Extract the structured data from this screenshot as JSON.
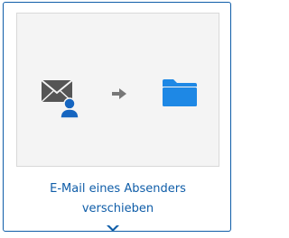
{
  "tile": {
    "caption_line1": "E-Mail eines Absenders",
    "caption_line2": "verschieben",
    "icons": [
      "envelope-with-user-icon",
      "arrow-right-icon",
      "folder-icon"
    ]
  },
  "colors": {
    "accent": "#0f5da8",
    "folder": "#1e88e5",
    "envelope": "#555555",
    "user": "#1565c0",
    "arrow": "#777777",
    "preview_bg": "#f4f4f4"
  }
}
